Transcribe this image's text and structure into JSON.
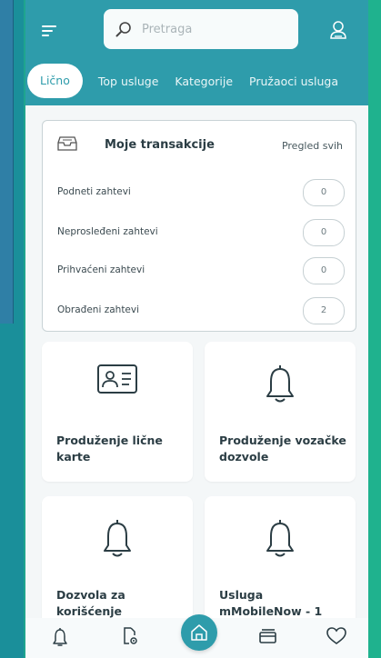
{
  "search": {
    "placeholder": "Pretraga"
  },
  "tabs": [
    {
      "label": "Lično",
      "active": true
    },
    {
      "label": "Top usluge"
    },
    {
      "label": "Kategorije"
    },
    {
      "label": "Pružaoci usluga"
    }
  ],
  "transactions": {
    "title": "Moje transakcije",
    "view_all": "Pregled svih",
    "rows": [
      {
        "label": "Podneti zahtevi",
        "count": "0"
      },
      {
        "label": "Neprosleđeni zahtevi",
        "count": "0"
      },
      {
        "label": "Prihvaćeni zahtevi",
        "count": "0"
      },
      {
        "label": "Obrađeni zahtevi",
        "count": "2"
      }
    ]
  },
  "services": [
    {
      "title": "Produženje lične karte",
      "icon": "id-card-icon"
    },
    {
      "title": "Produženje vozačke dozvole",
      "icon": "bell-icon"
    },
    {
      "title": "Dozvola za korišćenje",
      "icon": "bell-icon"
    },
    {
      "title": "Usluga mMobileNow - 1",
      "icon": "bell-icon"
    }
  ],
  "bottom_nav": [
    "bell-icon",
    "document-settings-icon",
    "home-icon",
    "cards-icon",
    "heart-icon"
  ],
  "colors": {
    "primary": "#2e9cab",
    "background": "#f4f7f8",
    "text": "#2b3d44"
  }
}
